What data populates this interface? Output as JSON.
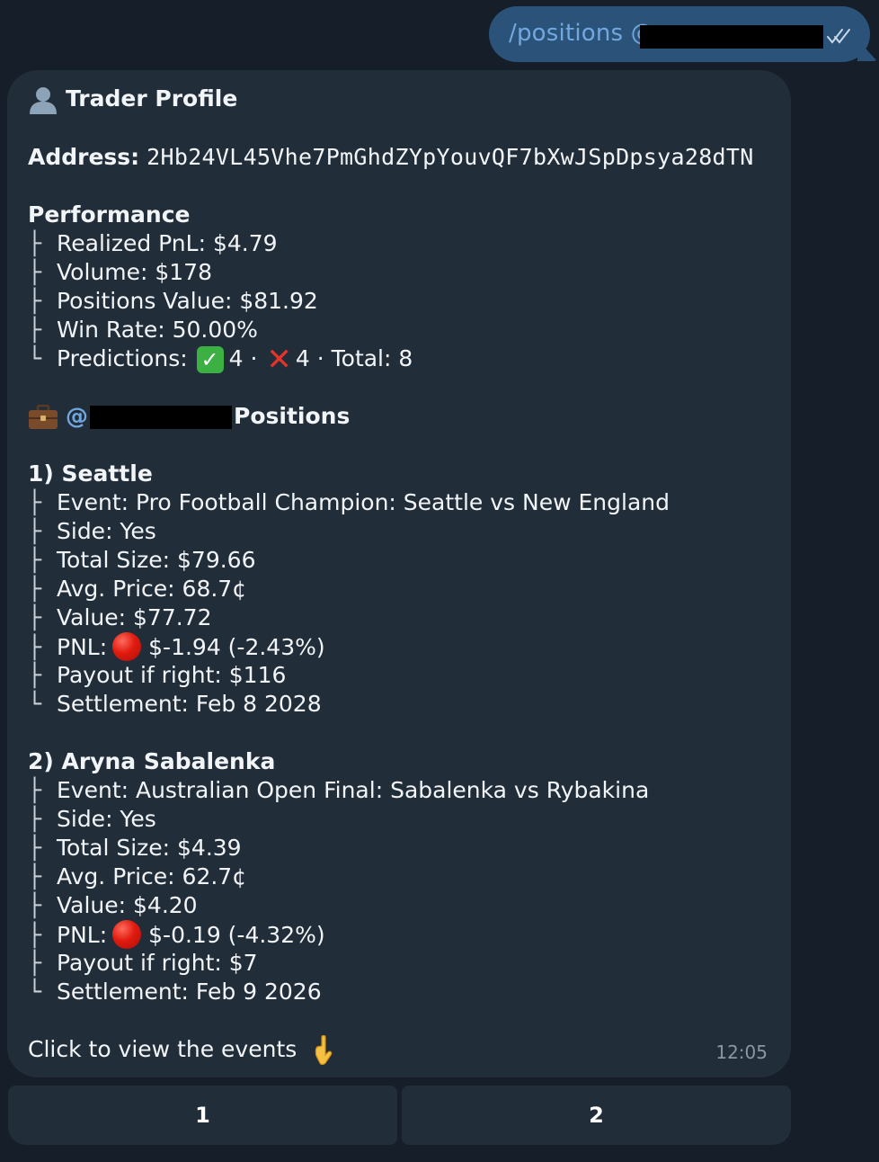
{
  "outgoing": {
    "text": "/positions @",
    "status_icon": "double-check-icon"
  },
  "message": {
    "title": "Trader Profile",
    "title_icon": "person-silhouette-icon",
    "address_label": "Address:",
    "address_value": "2Hb24VL45Vhe7PmGhdZYpYouvQF7bXwJSpDpsya28dTN",
    "performance": {
      "heading": "Performance",
      "items": [
        {
          "tree": "├",
          "text": "Realized PnL: $4.79"
        },
        {
          "tree": "├",
          "text": "Volume: $178"
        },
        {
          "tree": "├",
          "text": "Positions Value: $81.92"
        },
        {
          "tree": "├",
          "text": "Win Rate: 50.00%"
        }
      ],
      "predictions": {
        "tree": "└",
        "label": "Predictions:",
        "wins_icon": "check-mark-emoji",
        "wins": "4 ·",
        "losses_icon": "cross-mark-emoji",
        "losses": "4 · Total: 8"
      }
    },
    "positions_header": {
      "icon": "briefcase-icon",
      "at": "@",
      "label": "Positions"
    },
    "positions": [
      {
        "heading": "1) Seattle",
        "event": "Event: Pro Football Champion: Seattle vs New England",
        "side": "Side: Yes",
        "total_size": "Total Size: $79.66",
        "avg_price": "Avg. Price: 68.7¢",
        "value": "Value: $77.72",
        "pnl_label": "PNL:",
        "pnl_value": "$-1.94 (-2.43%)",
        "payout": "Payout if right: $116",
        "settlement": "Settlement: Feb 8 2028"
      },
      {
        "heading": "2) Aryna Sabalenka",
        "event": "Event: Australian Open Final: Sabalenka vs Rybakina",
        "side": "Side: Yes",
        "total_size": "Total Size: $4.39",
        "avg_price": "Avg. Price: 62.7¢",
        "value": "Value: $4.20",
        "pnl_label": "PNL:",
        "pnl_value": "$-0.19 (-4.32%)",
        "payout": "Payout if right: $7",
        "settlement": "Settlement: Feb 9 2026"
      }
    ],
    "footer_text": "Click to view the events",
    "footer_icon": "pointing-down-hand-emoji",
    "time": "12:05"
  },
  "keyboard": {
    "buttons": [
      "1",
      "2"
    ]
  },
  "tree_chars": {
    "branch": "├",
    "last": "└"
  }
}
